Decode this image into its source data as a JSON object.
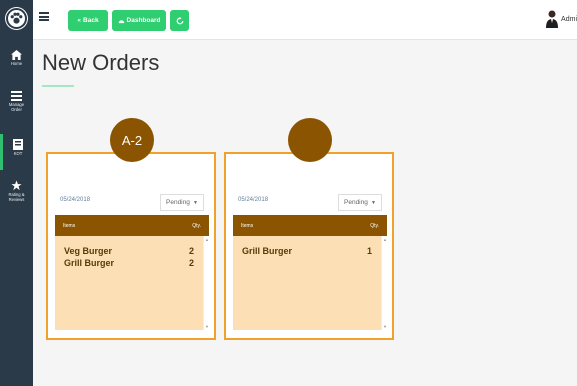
{
  "sidebar": {
    "items": [
      {
        "label": "Home",
        "icon": "home-icon"
      },
      {
        "label": "Manage Order",
        "icon": "list-icon"
      },
      {
        "label": "KOT",
        "icon": "kot-icon"
      },
      {
        "label": "Rating & Reviews",
        "icon": "star-icon"
      }
    ]
  },
  "topbar": {
    "back_label": "Back",
    "dashboard_label": "Dashboard",
    "user_name": "Admi"
  },
  "page": {
    "title": "New Orders"
  },
  "orders": [
    {
      "badge": "A-2",
      "date": "05/24/2018",
      "status": "Pending",
      "items_header": "Items",
      "qty_header": "Qty.",
      "items": [
        {
          "name": "Veg Burger",
          "qty": "2"
        },
        {
          "name": "Grill Burger",
          "qty": "2"
        }
      ]
    },
    {
      "badge": "",
      "date": "05/24/2018",
      "status": "Pending",
      "items_header": "Items",
      "qty_header": "Qty.",
      "items": [
        {
          "name": "Grill Burger",
          "qty": "1"
        }
      ]
    }
  ],
  "colors": {
    "sidebar": "#2b3a49",
    "accent_green": "#2fce71",
    "card_border": "#f0a12a",
    "brown": "#8b5400",
    "row_bg": "#fddfb6"
  }
}
